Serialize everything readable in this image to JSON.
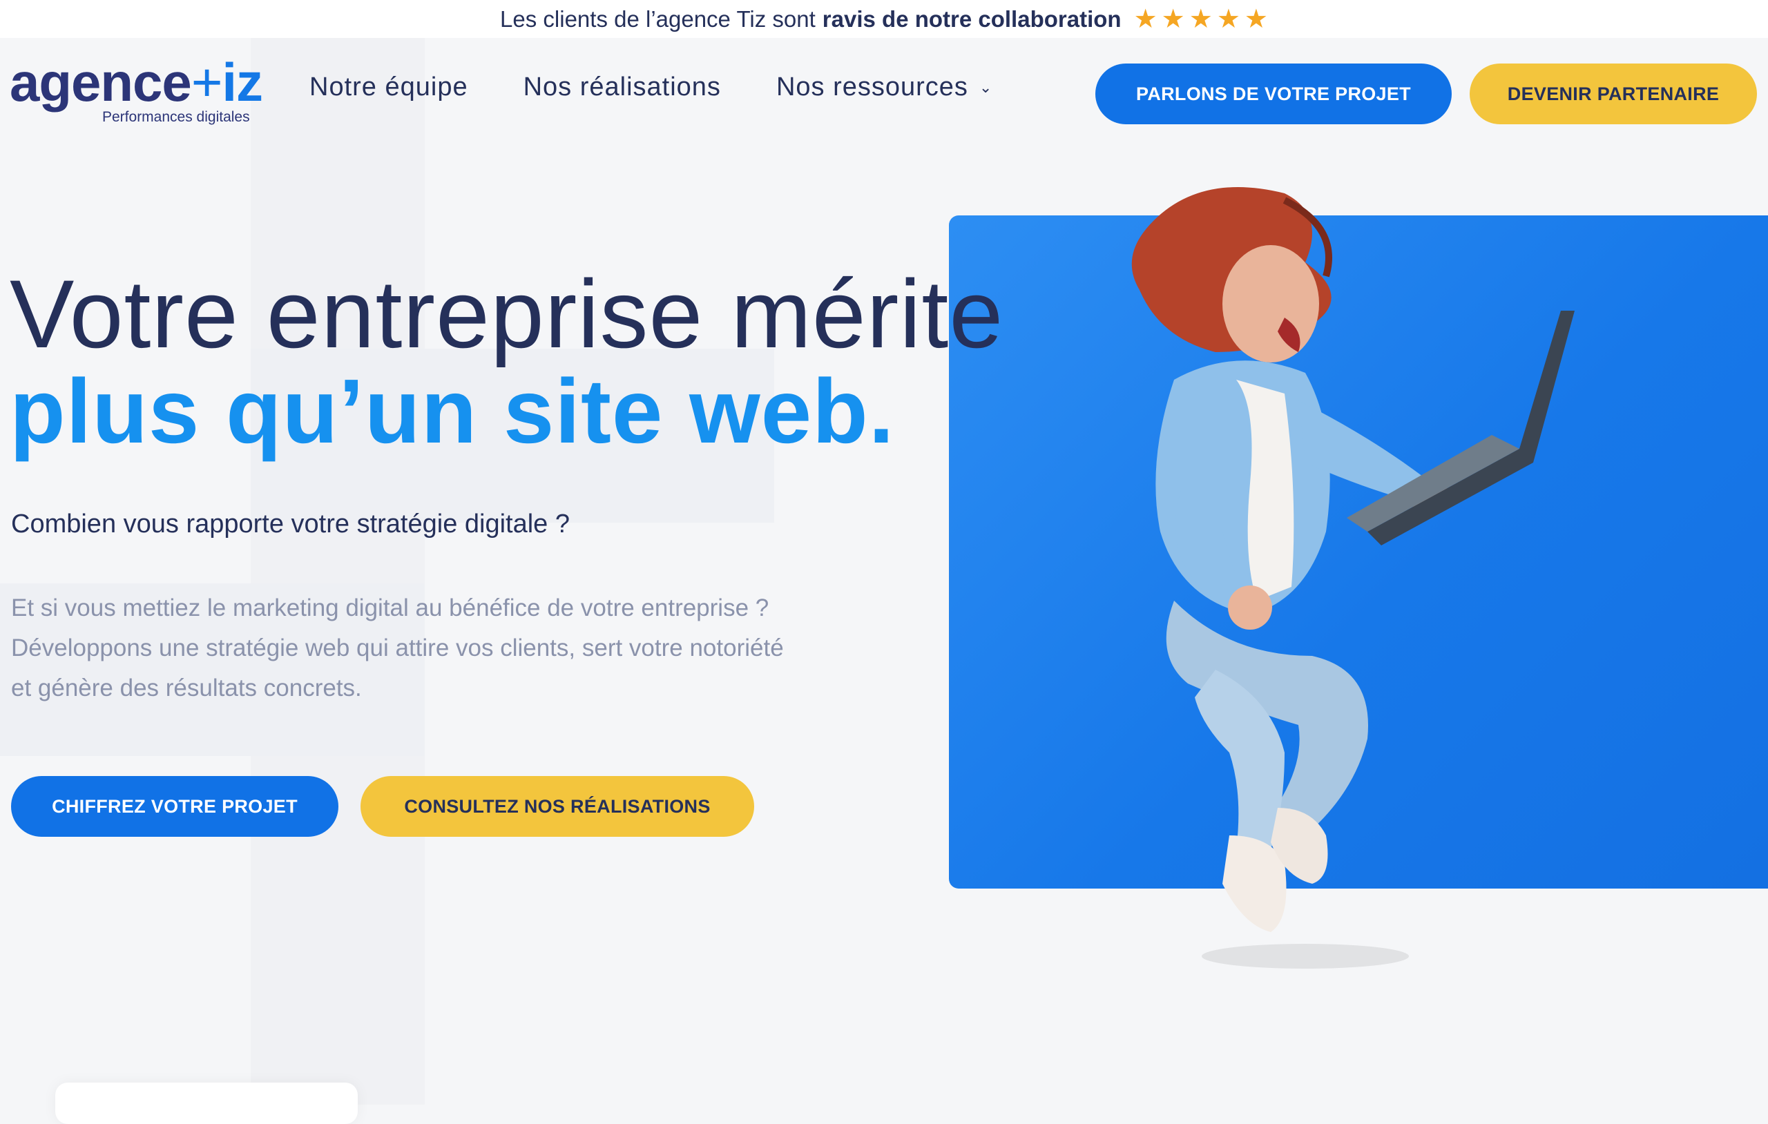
{
  "topbar": {
    "text_normal": "Les clients de l’agence Tiz sont",
    "text_bold": "ravis de notre collaboration",
    "stars": 5,
    "star_color": "#f5a623"
  },
  "logo": {
    "word_left": "agence",
    "word_right": "iz",
    "tagline": "Performances digitales"
  },
  "nav": {
    "items": [
      {
        "label": "Notre équipe"
      },
      {
        "label": "Nos réalisations"
      },
      {
        "label": "Nos ressources",
        "has_dropdown": true
      }
    ],
    "cta_primary": "PARLONS DE VOTRE PROJET",
    "cta_secondary": "DEVENIR PARTENAIRE"
  },
  "hero": {
    "title_line1": "Votre entreprise mérite",
    "title_line2": "plus qu’un site web.",
    "subtitle": "Combien vous rapporte votre stratégie digitale ?",
    "paragraph_lines": [
      "Et si vous mettiez le marketing digital au bénéfice de votre entreprise ?",
      "Développons une stratégie web qui attire vos clients, sert votre notoriété",
      "et génère des résultats concrets."
    ],
    "cta_primary": "CHIFFREZ VOTRE PROJET",
    "cta_secondary": "CONSULTEZ NOS RÉALISATIONS"
  },
  "colors": {
    "navy": "#25305a",
    "blue": "#1172e6",
    "light_blue": "#1691ef",
    "yellow": "#f3c53d",
    "gray_text": "#8a92ab"
  }
}
